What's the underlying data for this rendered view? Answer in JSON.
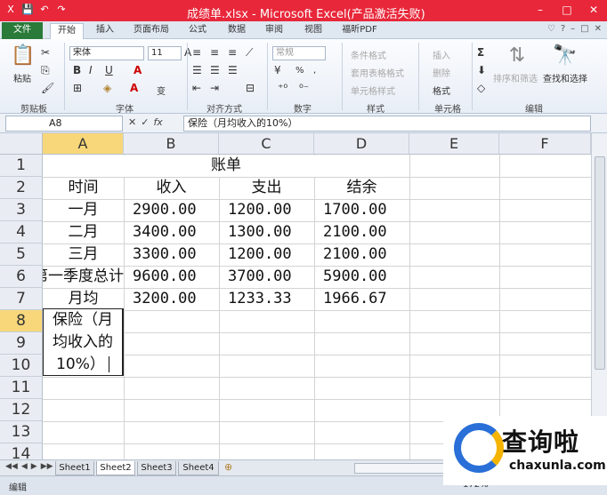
{
  "window": {
    "title": "成绩单.xlsx - Microsoft Excel(产品激活失败)",
    "controls": [
      "–",
      "□",
      "✕"
    ]
  },
  "qat": {
    "save": "💾",
    "undo": "↶",
    "redo": "↷"
  },
  "ribbon_tabs": [
    "文件",
    "开始",
    "插入",
    "页面布局",
    "公式",
    "数据",
    "审阅",
    "视图",
    "福昕PDF"
  ],
  "ribbon_right": [
    "♡",
    "?",
    "–",
    "□",
    "✕"
  ],
  "ribbon": {
    "clipboard": {
      "label": "剪贴板",
      "paste": "粘贴"
    },
    "font": {
      "label": "字体",
      "name": "宋体",
      "size": "11",
      "bold": "B",
      "italic": "I",
      "underline": "U",
      "fontcolor": "A",
      "wen": "变"
    },
    "alignment": {
      "label": "对齐方式"
    },
    "number": {
      "label": "数字",
      "format": "常规",
      "percent": "%",
      "comma": ","
    },
    "styles": {
      "label": "样式",
      "conditional": "条件格式",
      "table": "套用表格格式",
      "cell_styles": "单元格样式"
    },
    "cells": {
      "label": "单元格",
      "insert": "插入",
      "delete": "删除",
      "format": "格式"
    },
    "editing": {
      "label": "编辑",
      "sum": "Σ",
      "sort": "排序和筛选",
      "find": "查找和选择"
    }
  },
  "formula_bar": {
    "name_box": "A8",
    "fx": "fx",
    "cancel": "✕",
    "enter": "✓",
    "content": "保险（月均收入的10%）"
  },
  "columns": [
    "A",
    "B",
    "C",
    "D",
    "E",
    "F"
  ],
  "rows": [
    "1",
    "2",
    "3",
    "4",
    "5",
    "6",
    "7",
    "8",
    "9",
    "10",
    "11",
    "12",
    "13",
    "14"
  ],
  "sheet": {
    "title": "账单",
    "headers": [
      "时间",
      "收入",
      "支出",
      "结余"
    ],
    "data": [
      [
        "一月",
        "2900.00",
        "1200.00",
        "1700.00"
      ],
      [
        "二月",
        "3400.00",
        "1300.00",
        "2100.00"
      ],
      [
        "三月",
        "3300.00",
        "1200.00",
        "2100.00"
      ],
      [
        "第一季度总计",
        "9600.00",
        "3700.00",
        "5900.00"
      ],
      [
        "月均",
        "3200.00",
        "1233.33",
        "1966.67"
      ]
    ],
    "editing_lines": [
      "保险（月",
      "均收入的",
      "10%）"
    ]
  },
  "sheet_tabs": [
    "Sheet1",
    "Sheet2",
    "Sheet3",
    "Sheet4"
  ],
  "sheet_nav": [
    "◀◀",
    "◀",
    "▶",
    "▶▶"
  ],
  "status": {
    "mode": "编辑",
    "zoom": "172%"
  },
  "watermark": {
    "cn": "查询啦",
    "en": "chaxunla.com"
  }
}
